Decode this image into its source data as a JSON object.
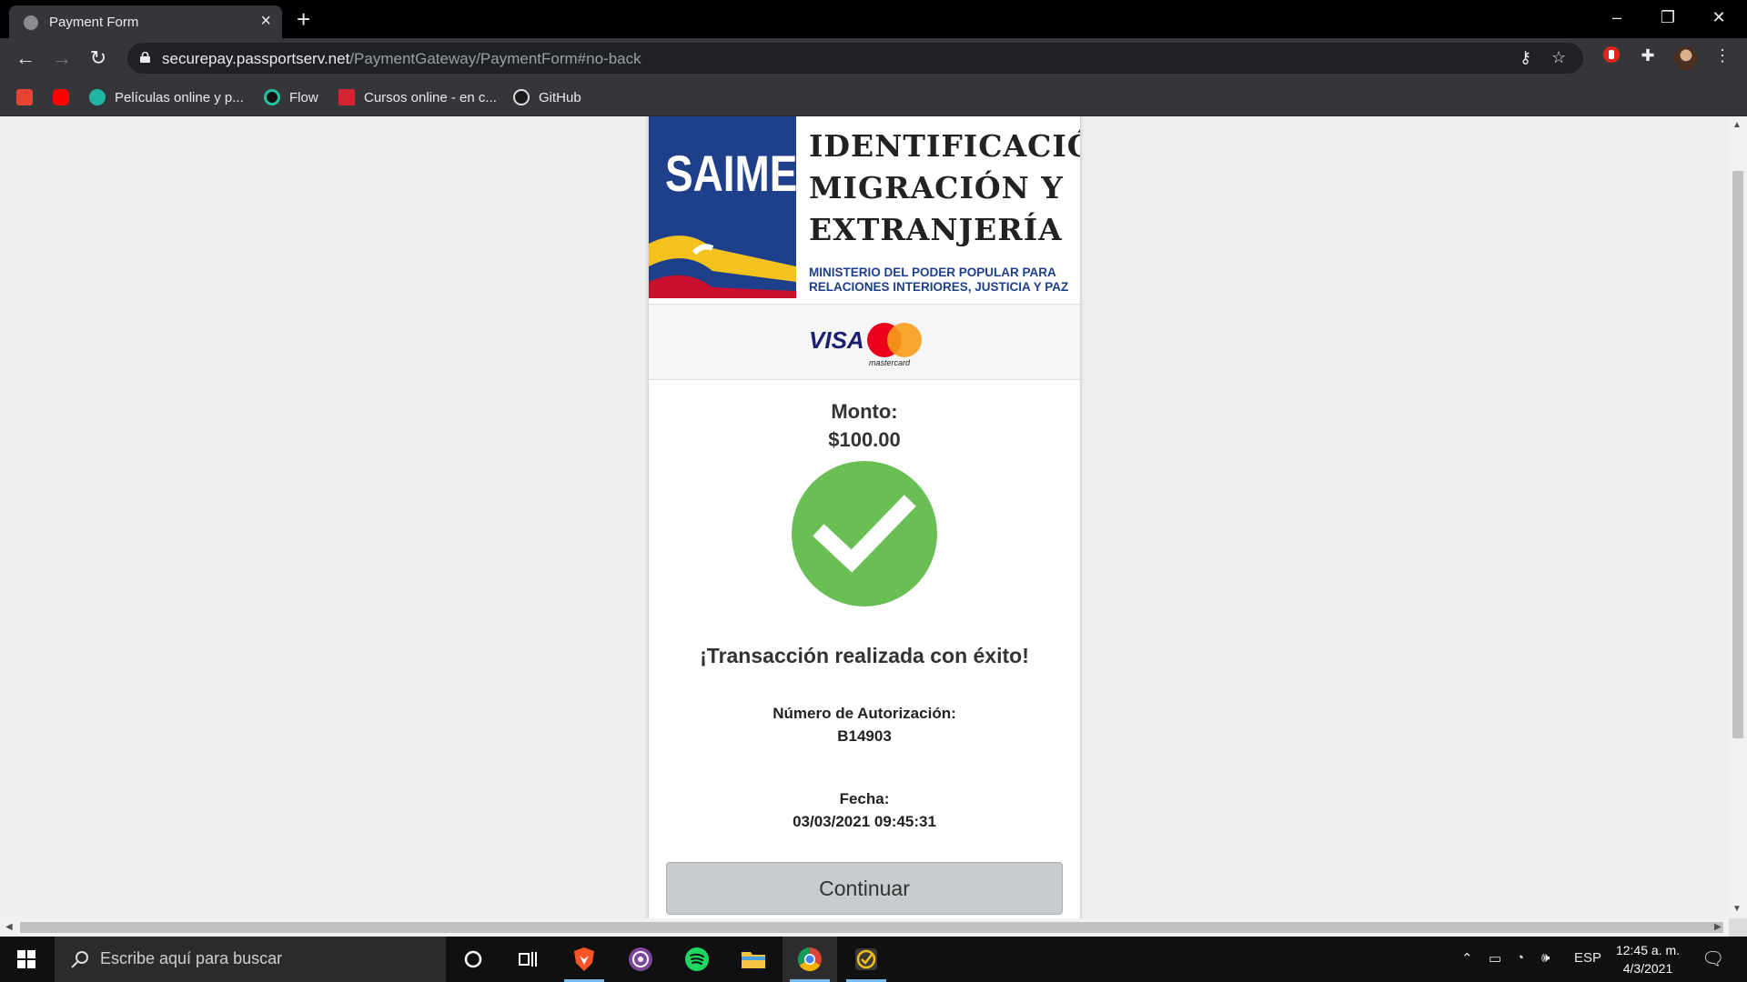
{
  "browser": {
    "tab_title": "Payment Form",
    "new_tab_label": "+",
    "url_host": "securepay.passportserv.net",
    "url_path": "/PaymentGateway/PaymentForm#no-back",
    "bookmarks": [
      {
        "label": "",
        "icon": "gmail-icon"
      },
      {
        "label": "",
        "icon": "youtube-icon"
      },
      {
        "label": "Películas online y p...",
        "icon": "cuevana-icon"
      },
      {
        "label": "Flow",
        "icon": "flow-icon"
      },
      {
        "label": "Cursos online - en c...",
        "icon": "udemy-icon"
      },
      {
        "label": "GitHub",
        "icon": "github-icon"
      }
    ]
  },
  "page": {
    "header": {
      "logo_text": "SAIME",
      "lines": [
        "IDENTIFICACIÓN",
        "MIGRACIÓN Y",
        "EXTRANJERÍA"
      ],
      "ministerio_1": "MINISTERIO DEL PODER POPULAR PARA",
      "ministerio_2": "RELACIONES INTERIORES, JUSTICIA Y PAZ"
    },
    "card_brands": {
      "visa": "VISA",
      "mastercard": "mastercard"
    },
    "monto_label": "Monto:",
    "monto_value": "$100.00",
    "success_message": "¡Transacción realizada con éxito!",
    "auth_label": "Número de Autorización:",
    "auth_value": "B14903",
    "fecha_label": "Fecha:",
    "fecha_value": "03/03/2021 09:45:31",
    "continue_label": "Continuar"
  },
  "taskbar": {
    "search_placeholder": "Escribe aquí para buscar",
    "language": "ESP",
    "time": "12:45 a. m.",
    "date": "4/3/2021"
  },
  "colors": {
    "success_green": "#6abf54",
    "saime_blue": "#1e3f8a",
    "button_gray": "#c8cccf"
  }
}
